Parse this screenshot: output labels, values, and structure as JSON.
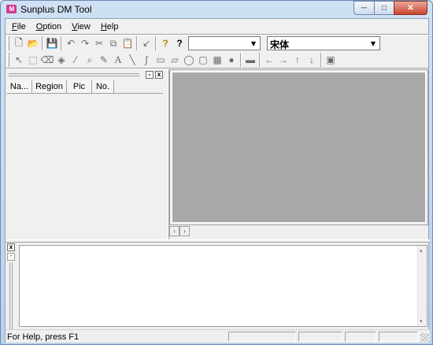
{
  "window": {
    "title": "Sunplus DM Tool",
    "app_icon_text": "M"
  },
  "caption_buttons": {
    "minimize": "─",
    "maximize": "□",
    "close": "✕"
  },
  "menu": [
    {
      "label_underlined": "F",
      "label_rest": "ile"
    },
    {
      "label_underlined": "O",
      "label_rest": "ption"
    },
    {
      "label_underlined": "V",
      "label_rest": "iew"
    },
    {
      "label_underlined": "H",
      "label_rest": "elp"
    }
  ],
  "toolbar1": {
    "new": "🗋",
    "open": "📂",
    "save": "💾",
    "undo": "↶",
    "redo": "↷",
    "cut": "✂",
    "copy": "⧉",
    "paste": "📋",
    "check": "↙",
    "help": "?",
    "context_help": "?",
    "combo1_value": "",
    "font_combo_value": "宋体"
  },
  "toolbar2": {
    "select": "↖",
    "rect_select": "⬚",
    "eraser": "⌫",
    "fill": "◈",
    "eyedropper": "⁄",
    "zoom": "⌕",
    "pencil": "✎",
    "text": "A",
    "line": "╲",
    "curve": "∫",
    "rectangle": "▭",
    "polygon": "▱",
    "ellipse": "◯",
    "rounded_rect": "▢",
    "grid": "▦",
    "circle_fill": "●",
    "tool_extra": "▬",
    "arrow_left": "←",
    "arrow_right": "→",
    "arrow_up": "↑",
    "arrow_down": "↓",
    "tool_last": "▣"
  },
  "left_panel": {
    "columns": [
      "Na...",
      "Region",
      "Pic",
      "No."
    ],
    "min_button": "-",
    "close_button": "x"
  },
  "scroll": {
    "left": "‹",
    "right": "›",
    "up": "▴",
    "down": "▾"
  },
  "output_panel": {
    "close_button": "x",
    "mini_button": "-"
  },
  "status": {
    "text": "For Help, press F1"
  }
}
